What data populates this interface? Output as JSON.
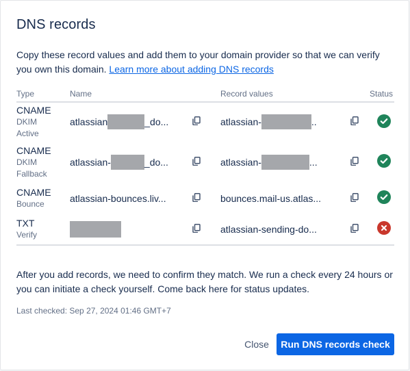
{
  "dialog": {
    "title": "DNS records",
    "intro_text": "Copy these record values and add them to your domain provider so that we can verify you own this domain. ",
    "learn_more_link": "Learn more about adding DNS records"
  },
  "table": {
    "headers": {
      "type": "Type",
      "name": "Name",
      "values": "Record values",
      "status": "Status"
    },
    "rows": [
      {
        "type": "CNAME",
        "sub1": "DKIM",
        "sub2": "Active",
        "name_prefix": "atlassian",
        "name_suffix": "_do...",
        "value_prefix": "atlassian-",
        "value_suffix": "..",
        "status": "verified",
        "status_icon": "check-circle-icon"
      },
      {
        "type": "CNAME",
        "sub1": "DKIM",
        "sub2": "Fallback",
        "name_prefix": "atlassian-",
        "name_suffix": "_do...",
        "value_prefix": "atlassian-",
        "value_suffix": "...",
        "status": "verified",
        "status_icon": "check-circle-icon"
      },
      {
        "type": "CNAME",
        "sub1": "Bounce",
        "sub2": "",
        "name_prefix": "atlassian-bounces.liv...",
        "name_suffix": "",
        "value_prefix": "bounces.mail-us.atlas...",
        "value_suffix": "",
        "status": "verified",
        "status_icon": "check-circle-icon"
      },
      {
        "type": "TXT",
        "sub1": "Verify",
        "sub2": "",
        "name_prefix": "",
        "name_suffix": "",
        "value_prefix": "atlassian-sending-do...",
        "value_suffix": "",
        "status": "failed",
        "status_icon": "error-circle-icon"
      }
    ]
  },
  "after_text": "After you add records, we need to confirm they match. We run a check every 24 hours or you can initiate a check yourself. Come back here for status updates.",
  "last_checked": "Last checked: Sep 27, 2024 01:46 GMT+7",
  "buttons": {
    "close": "Close",
    "run": "Run DNS records check"
  },
  "colors": {
    "primary": "#0c66e4",
    "success": "#1f845a",
    "danger": "#c9372c",
    "redaction": "#a5a7ab"
  }
}
